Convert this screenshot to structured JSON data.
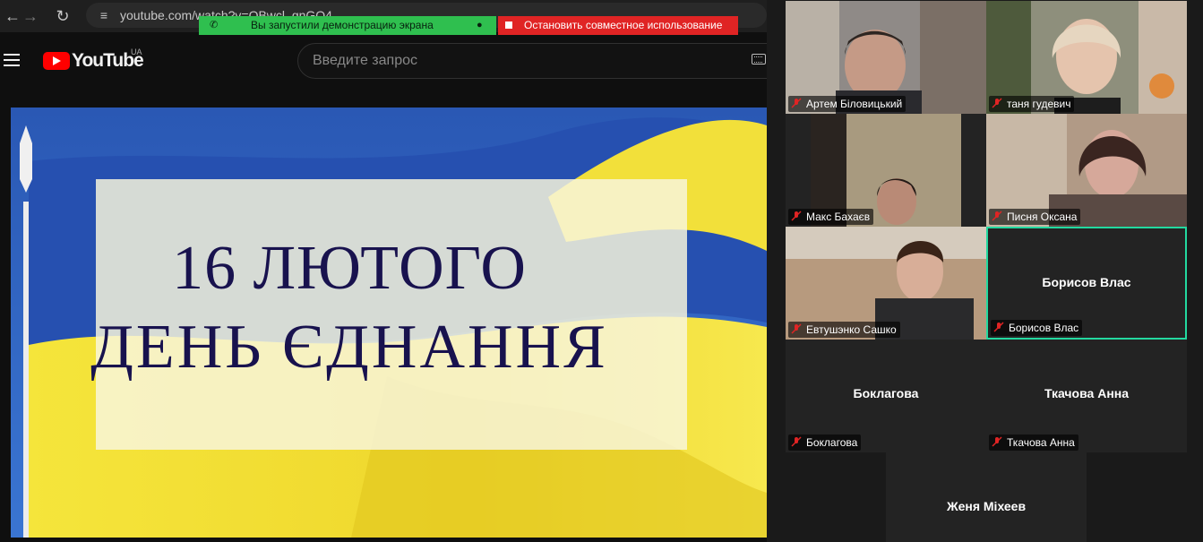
{
  "browser": {
    "url": "youtube.com/watch?v=OBwcl_gnGO4"
  },
  "screen_share": {
    "status_text": "Вы запустили демонстрацию экрана",
    "stop_label": "Остановить совместное использование"
  },
  "youtube": {
    "wordmark": "YouTube",
    "region": "UA",
    "search_placeholder": "Введите запрос"
  },
  "video": {
    "title_line1": "16 ЛЮТОГО",
    "title_line2": "ДЕНЬ ЄДНАННЯ"
  },
  "participants": [
    {
      "name": "Артем Біловицький",
      "has_video": true
    },
    {
      "name": "таня гудевич",
      "has_video": true
    },
    {
      "name": "Макс Бахаєв",
      "has_video": true
    },
    {
      "name": "Писня Оксана",
      "has_video": true
    },
    {
      "name": "Евтушэнко Сашко",
      "has_video": true
    },
    {
      "name": "Борисов Влас",
      "has_video": false,
      "active_speaker": true
    },
    {
      "name": "Боклагова",
      "has_video": false
    },
    {
      "name": "Ткачова Анна",
      "has_video": false
    },
    {
      "name": "Женя Міхеев",
      "has_video": false
    }
  ],
  "colors": {
    "flag_blue": "#2d62c2",
    "flag_yellow": "#f3e23a",
    "share_green": "#2fbf4f",
    "share_red": "#e02424",
    "active_speaker_border": "#23d9a0",
    "muted_mic": "#e02424"
  },
  "icons": {
    "back": "arrow-left-icon",
    "forward": "arrow-right-icon",
    "reload": "reload-icon",
    "site_info": "tune-icon",
    "menu": "hamburger-icon",
    "keyboard": "keyboard-icon",
    "mic": "mic-muted-icon"
  }
}
